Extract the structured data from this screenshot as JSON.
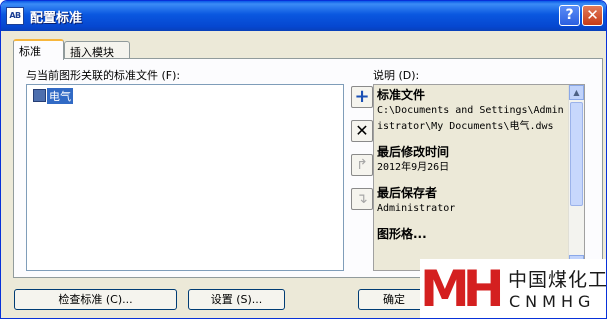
{
  "window": {
    "title": "配置标准",
    "icon_text": "AB",
    "help_label": "?",
    "close_label": "✕"
  },
  "tabs": [
    {
      "label": "标准",
      "active": true
    },
    {
      "label": "插入模块",
      "active": false
    }
  ],
  "files_section": {
    "label": "与当前图形关联的标准文件 (F):",
    "items": [
      {
        "label": "电气",
        "selected": true,
        "icon": "standards-file-icon"
      }
    ]
  },
  "side_buttons": {
    "add": "+",
    "remove": "✕",
    "move_up": "↱",
    "move_down": "↴"
  },
  "description": {
    "label": "说明 (D):",
    "file_heading": "标准文件",
    "file_path": "C:\\Documents and Settings\\Administrator\\My Documents\\电气.dws",
    "modified_heading": "最后修改时间",
    "modified_value": "2012年9月26日",
    "saved_by_heading": "最后保存者",
    "saved_by_value": "Administrator",
    "next_heading_partial": "图形格..."
  },
  "bottom_buttons": {
    "check": "检查标准 (C)...",
    "settings": "设置 (S)...",
    "ok": "确定"
  },
  "watermark": {
    "cn_text": "中国煤化工",
    "en_text": "CNMHG",
    "brand_color": "#d42020"
  }
}
